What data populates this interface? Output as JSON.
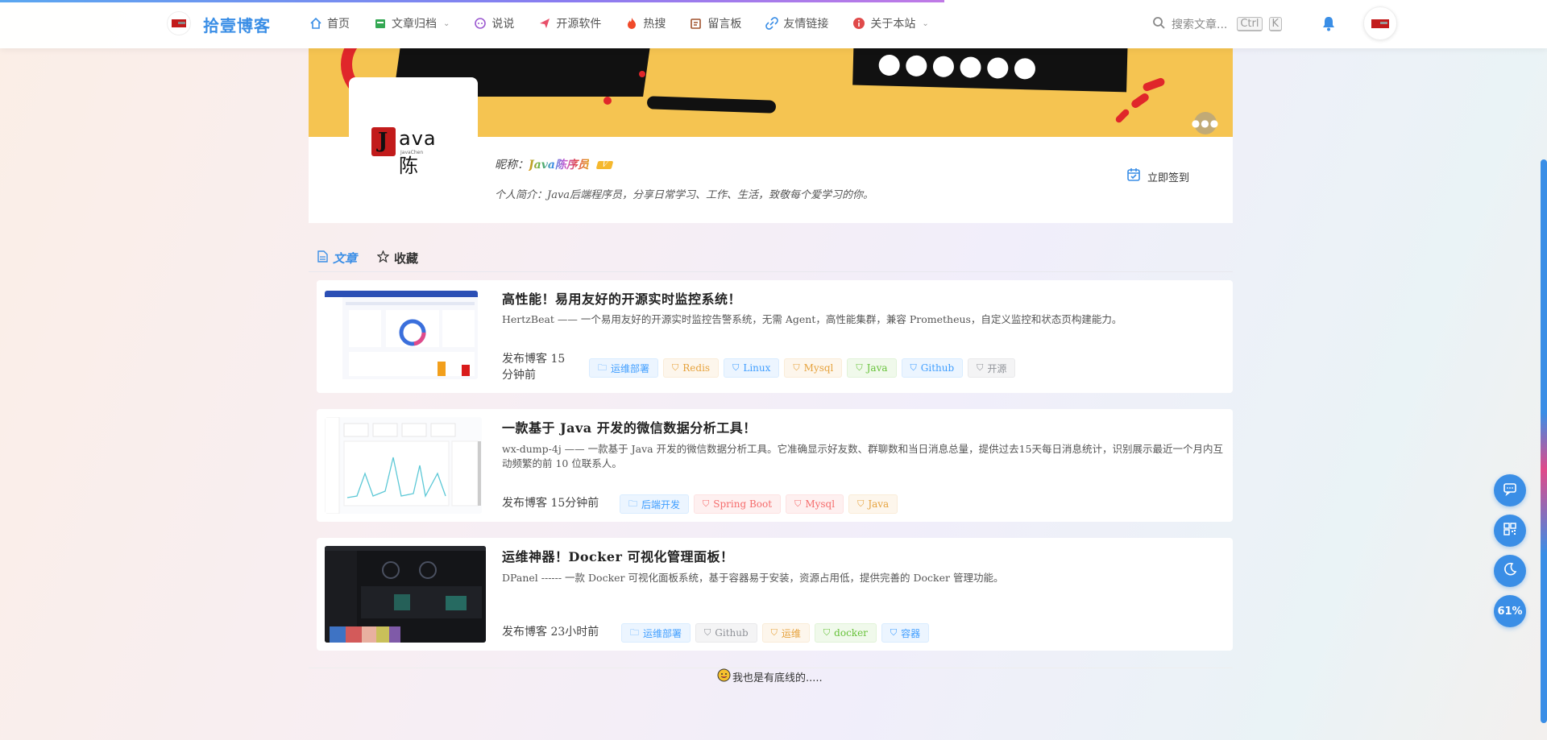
{
  "header": {
    "site_title": "拾壹博客",
    "nav": [
      {
        "label": "首页",
        "icon": "home-icon",
        "color": "#3a8ee6"
      },
      {
        "label": "文章归档",
        "icon": "archive-icon",
        "color": "#34a853",
        "dropdown": true
      },
      {
        "label": "说说",
        "icon": "chat-icon",
        "color": "#9b59d0"
      },
      {
        "label": "开源软件",
        "icon": "send-icon",
        "color": "#e8506a"
      },
      {
        "label": "热搜",
        "icon": "fire-icon",
        "color": "#f04a2a"
      },
      {
        "label": "留言板",
        "icon": "message-board-icon",
        "color": "#a0522d"
      },
      {
        "label": "友情链接",
        "icon": "link-icon",
        "color": "#3a8ee6"
      },
      {
        "label": "关于本站",
        "icon": "info-icon",
        "color": "#e04a4a",
        "dropdown": true
      }
    ],
    "search_placeholder": "搜索文章...",
    "kbd_ctrl": "Ctrl",
    "kbd_k": "K"
  },
  "profile": {
    "nickname_label": "昵称：",
    "nickname": "Java陈序员",
    "badge": "V",
    "intro": "个人简介：Java后端程序员，分享日常学习、工作、生活，致敬每个爱学习的你。",
    "signin_label": "立即签到",
    "avatar_text": "ava陈",
    "avatar_sub": "JavaChen"
  },
  "tabs": [
    {
      "label": "文章",
      "icon": "document-icon",
      "active": true
    },
    {
      "label": "收藏",
      "icon": "star-icon",
      "active": false
    }
  ],
  "articles": [
    {
      "title": "高性能！易用友好的开源实时监控系统！",
      "desc": "HertzBeat —— 一个易用友好的开源实时监控告警系统，无需 Agent，高性能集群，兼容 Prometheus，自定义监控和状态页构建能力。",
      "meta": "发布博客 15分钟前",
      "tags": [
        {
          "label": "运维部署",
          "style": "blue",
          "icon": "folder-icon"
        },
        {
          "label": "Redis",
          "style": "orange",
          "icon": "bookmark-icon"
        },
        {
          "label": "Linux",
          "style": "blue",
          "icon": "bookmark-icon"
        },
        {
          "label": "Mysql",
          "style": "orange",
          "icon": "bookmark-icon"
        },
        {
          "label": "Java",
          "style": "green",
          "icon": "bookmark-icon"
        },
        {
          "label": "Github",
          "style": "blue",
          "icon": "bookmark-icon"
        },
        {
          "label": "开源",
          "style": "gray",
          "icon": "bookmark-icon"
        }
      ]
    },
    {
      "title": "一款基于 Java 开发的微信数据分析工具！",
      "desc": "wx-dump-4j —— 一款基于 Java 开发的微信数据分析工具。它准确显示好友数、群聊数和当日消息总量，提供过去15天每日消息统计，识别展示最近一个月内互动频繁的前 10 位联系人。",
      "meta": "发布博客 15分钟前",
      "tags": [
        {
          "label": "后端开发",
          "style": "blue",
          "icon": "folder-icon"
        },
        {
          "label": "Spring Boot",
          "style": "red",
          "icon": "bookmark-icon"
        },
        {
          "label": "Mysql",
          "style": "red",
          "icon": "bookmark-icon"
        },
        {
          "label": "Java",
          "style": "orange",
          "icon": "bookmark-icon"
        }
      ]
    },
    {
      "title": "运维神器！Docker 可视化管理面板！",
      "desc": "DPanel ------ 一款 Docker 可视化面板系统，基于容器易于安装，资源占用低，提供完善的 Docker 管理功能。",
      "meta": "发布博客 23小时前",
      "tags": [
        {
          "label": "运维部署",
          "style": "blue",
          "icon": "folder-icon"
        },
        {
          "label": "Github",
          "style": "gray",
          "icon": "bookmark-icon"
        },
        {
          "label": "运维",
          "style": "orange",
          "icon": "bookmark-icon"
        },
        {
          "label": "docker",
          "style": "green",
          "icon": "bookmark-icon"
        },
        {
          "label": "容器",
          "style": "blue",
          "icon": "bookmark-icon"
        }
      ]
    }
  ],
  "end_text": "我也是有底线的.....",
  "fabs": [
    {
      "name": "chat-fab",
      "icon": "message-icon"
    },
    {
      "name": "qrcode-fab",
      "icon": "qrcode-icon"
    },
    {
      "name": "dark-mode-fab",
      "icon": "moon-icon"
    },
    {
      "name": "scroll-progress-fab",
      "label": "61%"
    }
  ],
  "colors": {
    "accent": "#3a8ee6",
    "banner": "#f5c451"
  }
}
